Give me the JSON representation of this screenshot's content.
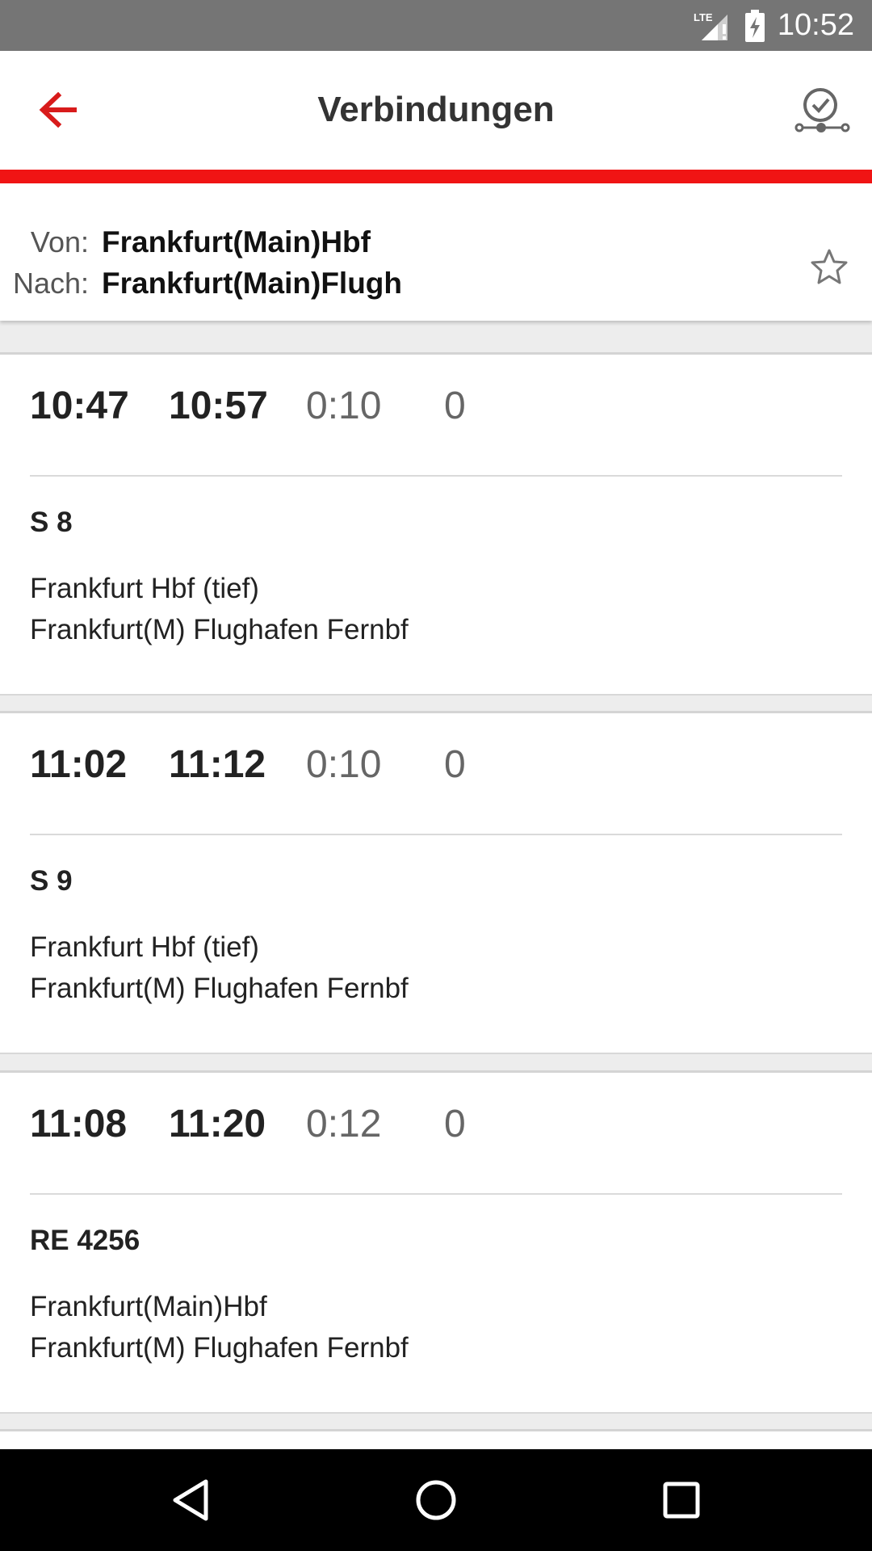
{
  "status_bar": {
    "network": "LTE",
    "time": "10:52"
  },
  "app_bar": {
    "title": "Verbindungen",
    "back_icon": "arrow-left-icon",
    "pin_icon": "clock-check-route-icon"
  },
  "route": {
    "from_label": "Von:",
    "from_value": "Frankfurt(Main)Hbf",
    "to_label": "Nach:",
    "to_value": "Frankfurt(Main)Flugh",
    "favorite_icon": "star-outline-icon"
  },
  "connections": [
    {
      "departure": "10:47",
      "arrival": "10:57",
      "duration": "0:10",
      "changes": "0",
      "train": "S 8",
      "from_station": "Frankfurt Hbf (tief)",
      "to_station": "Frankfurt(M) Flughafen Fernbf"
    },
    {
      "departure": "11:02",
      "arrival": "11:12",
      "duration": "0:10",
      "changes": "0",
      "train": "S 9",
      "from_station": "Frankfurt Hbf (tief)",
      "to_station": "Frankfurt(M) Flughafen Fernbf"
    },
    {
      "departure": "11:08",
      "arrival": "11:20",
      "duration": "0:12",
      "changes": "0",
      "train": "RE 4256",
      "from_station": "Frankfurt(Main)Hbf",
      "to_station": "Frankfurt(M) Flughafen Fernbf"
    }
  ],
  "nav_bar": {
    "back_icon": "triangle-back-icon",
    "home_icon": "circle-home-icon",
    "recents_icon": "square-recents-icon"
  },
  "colors": {
    "accent": "#f01414",
    "back_arrow": "#d81b1b",
    "status_bar": "#757575",
    "nav_bar": "#000000"
  }
}
